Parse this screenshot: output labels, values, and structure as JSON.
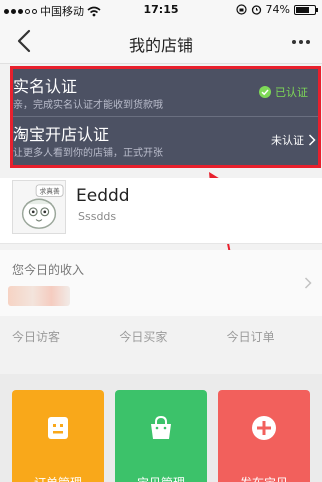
{
  "status_bar": {
    "carrier": "中国移动",
    "time": "17:15",
    "battery": "74%",
    "battery_level": 0.74
  },
  "nav": {
    "title": "我的店铺"
  },
  "verify": [
    {
      "title": "实名认证",
      "desc": "亲，完成实名认证才能收到货款哦",
      "status": "已认证"
    },
    {
      "title": "淘宝开店认证",
      "desc": "让更多人看到你的店铺，正式开张",
      "status": "未认证"
    }
  ],
  "store": {
    "logo_badge": "求真善",
    "name": "Eeddd",
    "subtitle": "Sssdds"
  },
  "income": {
    "label": "您今日的收入"
  },
  "stats": [
    {
      "label": "今日访客"
    },
    {
      "label": "今日买家"
    },
    {
      "label": "今日订单"
    }
  ],
  "actions": [
    {
      "label": "订单管理",
      "icon": "order-icon",
      "color": "#f9a81a"
    },
    {
      "label": "宝贝管理",
      "icon": "bag-icon",
      "color": "#3cc26a"
    },
    {
      "label": "发布宝贝",
      "icon": "plus-icon",
      "color": "#f2605c"
    }
  ],
  "colors": {
    "highlight_border": "#e8202d",
    "panel_bg": "#4c5163",
    "verified_green": "#7ed957"
  }
}
